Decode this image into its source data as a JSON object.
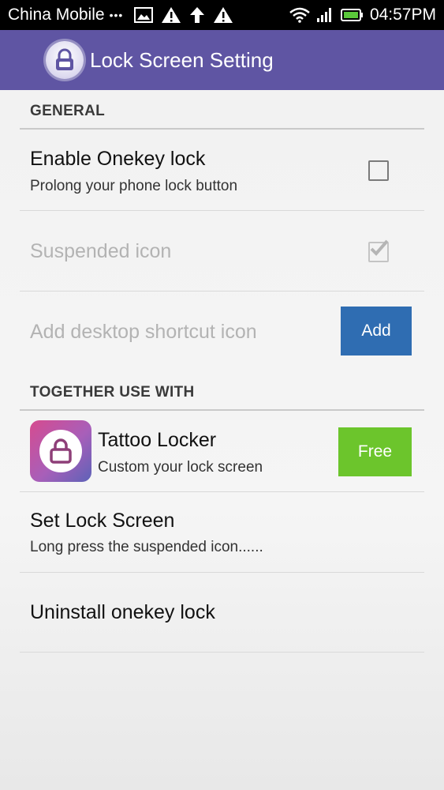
{
  "status_bar": {
    "carrier": "China Mobile",
    "dots": "•••",
    "time": "04:57PM"
  },
  "app_bar": {
    "title": "Lock Screen Setting",
    "color": "#5f55a3"
  },
  "sections": {
    "general": {
      "header": "GENERAL",
      "enable_onekey": {
        "title": "Enable Onekey lock",
        "subtitle": "Prolong your phone lock button",
        "checked": false
      },
      "suspended_icon": {
        "title": "Suspended icon",
        "checked": true,
        "enabled": false
      },
      "desktop_shortcut": {
        "title": "Add desktop shortcut icon",
        "button_label": "Add",
        "button_color": "#2f6db2"
      }
    },
    "together": {
      "header": "TOGETHER USE WITH",
      "tattoo_locker": {
        "title": "Tattoo Locker",
        "subtitle": "Custom your lock screen",
        "button_label": "Free",
        "button_color": "#6cc52c"
      },
      "set_lock_screen": {
        "title": "Set Lock Screen",
        "subtitle": "Long press the suspended icon......"
      },
      "uninstall": {
        "title": "Uninstall onekey lock"
      }
    }
  }
}
